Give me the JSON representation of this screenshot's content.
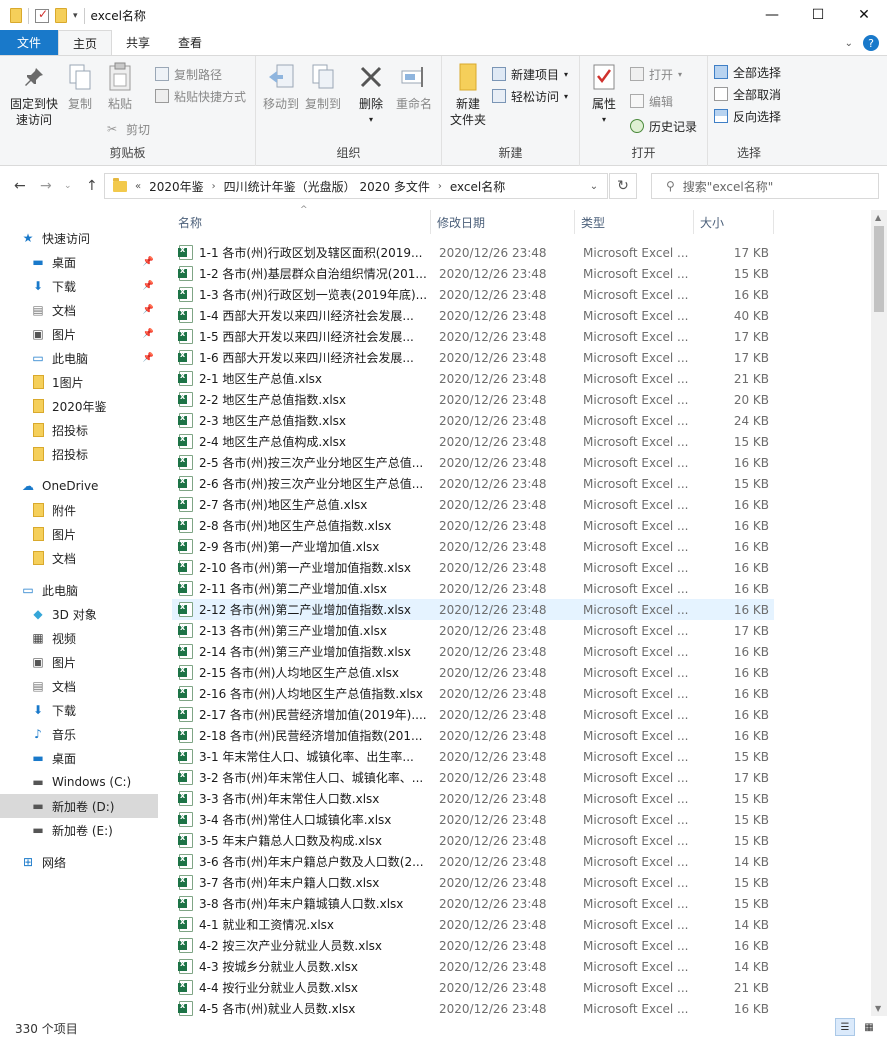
{
  "window": {
    "title": "excel名称",
    "controls": {
      "minimize": "—",
      "maximize": "☐",
      "close": "✕"
    }
  },
  "ribbon_tabs": [
    {
      "label": "文件"
    },
    {
      "label": "主页"
    },
    {
      "label": "共享"
    },
    {
      "label": "查看"
    }
  ],
  "ribbon": {
    "clipboard": {
      "label": "剪贴板",
      "pin_quick": "固定到快\n速访问",
      "copy": "复制",
      "paste": "粘贴",
      "copy_path": "复制路径",
      "paste_shortcut": "粘贴快捷方式",
      "cut": "剪切"
    },
    "organize": {
      "label": "组织",
      "move_to": "移动到",
      "copy_to": "复制到",
      "delete": "删除",
      "rename": "重命名"
    },
    "new": {
      "label": "新建",
      "new_folder": "新建\n文件夹",
      "new_item": "新建项目",
      "easy_access": "轻松访问"
    },
    "open": {
      "label": "打开",
      "properties": "属性",
      "open": "打开",
      "edit": "编辑",
      "history": "历史记录"
    },
    "select": {
      "label": "选择",
      "select_all": "全部选择",
      "select_none": "全部取消",
      "invert": "反向选择"
    }
  },
  "address": {
    "crumbs": [
      "2020年鉴",
      "四川统计年鉴（光盘版） 2020 多文件",
      "excel名称"
    ],
    "overflow": "«",
    "search_placeholder": "搜索\"excel名称\""
  },
  "sidebar": {
    "items": [
      {
        "label": "快速访问",
        "icon": "star-icon",
        "pinned": false,
        "selected": false
      },
      {
        "label": "桌面",
        "icon": "desktop-icon",
        "pinned": true,
        "selected": false
      },
      {
        "label": "下载",
        "icon": "download-icon",
        "pinned": true,
        "selected": false
      },
      {
        "label": "文档",
        "icon": "document-icon",
        "pinned": true,
        "selected": false
      },
      {
        "label": "图片",
        "icon": "pictures-icon",
        "pinned": true,
        "selected": false
      },
      {
        "label": "此电脑",
        "icon": "computer-icon",
        "pinned": true,
        "selected": false
      },
      {
        "label": "1图片",
        "icon": "folder-icon",
        "pinned": false,
        "selected": false
      },
      {
        "label": "2020年鉴",
        "icon": "folder-icon",
        "pinned": false,
        "selected": false
      },
      {
        "label": "招投标",
        "icon": "folder-icon",
        "pinned": false,
        "selected": false
      },
      {
        "label": "招投标",
        "icon": "folder-icon",
        "pinned": false,
        "selected": false
      },
      {
        "label": "OneDrive",
        "icon": "cloud-icon",
        "pinned": false,
        "selected": false
      },
      {
        "label": "附件",
        "icon": "folder-icon",
        "pinned": false,
        "selected": false
      },
      {
        "label": "图片",
        "icon": "folder-icon",
        "pinned": false,
        "selected": false
      },
      {
        "label": "文档",
        "icon": "folder-icon",
        "pinned": false,
        "selected": false
      },
      {
        "label": "此电脑",
        "icon": "computer-icon",
        "pinned": false,
        "selected": false
      },
      {
        "label": "3D 对象",
        "icon": "cube-icon",
        "pinned": false,
        "selected": false
      },
      {
        "label": "视频",
        "icon": "video-icon",
        "pinned": false,
        "selected": false
      },
      {
        "label": "图片",
        "icon": "pictures-icon",
        "pinned": false,
        "selected": false
      },
      {
        "label": "文档",
        "icon": "document-icon",
        "pinned": false,
        "selected": false
      },
      {
        "label": "下载",
        "icon": "download-icon",
        "pinned": false,
        "selected": false
      },
      {
        "label": "音乐",
        "icon": "music-icon",
        "pinned": false,
        "selected": false
      },
      {
        "label": "桌面",
        "icon": "desktop-icon",
        "pinned": false,
        "selected": false
      },
      {
        "label": "Windows (C:)",
        "icon": "drive-icon",
        "pinned": false,
        "selected": false
      },
      {
        "label": "新加卷 (D:)",
        "icon": "drive-icon",
        "pinned": false,
        "selected": true
      },
      {
        "label": "新加卷 (E:)",
        "icon": "drive-icon",
        "pinned": false,
        "selected": false
      },
      {
        "label": "网络",
        "icon": "network-icon",
        "pinned": false,
        "selected": false
      }
    ]
  },
  "columns": {
    "name": "名称",
    "date": "修改日期",
    "type": "类型",
    "size": "大小"
  },
  "files": [
    {
      "name": "1-1  各市(州)行政区划及辖区面积(2019...",
      "date": "2020/12/26 23:48",
      "type": "Microsoft Excel ...",
      "size": "17 KB"
    },
    {
      "name": "1-2  各市(州)基层群众自治组织情况(201...",
      "date": "2020/12/26 23:48",
      "type": "Microsoft Excel ...",
      "size": "15 KB"
    },
    {
      "name": "1-3  各市(州)行政区划一览表(2019年底)...",
      "date": "2020/12/26 23:48",
      "type": "Microsoft Excel ...",
      "size": "16 KB"
    },
    {
      "name": "1-4  西部大开发以来四川经济社会发展...",
      "date": "2020/12/26 23:48",
      "type": "Microsoft Excel ...",
      "size": "40 KB"
    },
    {
      "name": "1-5  西部大开发以来四川经济社会发展...",
      "date": "2020/12/26 23:48",
      "type": "Microsoft Excel ...",
      "size": "17 KB"
    },
    {
      "name": "1-6  西部大开发以来四川经济社会发展...",
      "date": "2020/12/26 23:48",
      "type": "Microsoft Excel ...",
      "size": "17 KB"
    },
    {
      "name": "2-1  地区生产总值.xlsx",
      "date": "2020/12/26 23:48",
      "type": "Microsoft Excel ...",
      "size": "21 KB"
    },
    {
      "name": "2-2  地区生产总值指数.xlsx",
      "date": "2020/12/26 23:48",
      "type": "Microsoft Excel ...",
      "size": "20 KB"
    },
    {
      "name": "2-3  地区生产总值指数.xlsx",
      "date": "2020/12/26 23:48",
      "type": "Microsoft Excel ...",
      "size": "24 KB"
    },
    {
      "name": "2-4  地区生产总值构成.xlsx",
      "date": "2020/12/26 23:48",
      "type": "Microsoft Excel ...",
      "size": "15 KB"
    },
    {
      "name": "2-5  各市(州)按三次产业分地区生产总值...",
      "date": "2020/12/26 23:48",
      "type": "Microsoft Excel ...",
      "size": "16 KB"
    },
    {
      "name": "2-6  各市(州)按三次产业分地区生产总值...",
      "date": "2020/12/26 23:48",
      "type": "Microsoft Excel ...",
      "size": "15 KB"
    },
    {
      "name": "2-7  各市(州)地区生产总值.xlsx",
      "date": "2020/12/26 23:48",
      "type": "Microsoft Excel ...",
      "size": "16 KB"
    },
    {
      "name": "2-8  各市(州)地区生产总值指数.xlsx",
      "date": "2020/12/26 23:48",
      "type": "Microsoft Excel ...",
      "size": "16 KB"
    },
    {
      "name": "2-9  各市(州)第一产业增加值.xlsx",
      "date": "2020/12/26 23:48",
      "type": "Microsoft Excel ...",
      "size": "16 KB"
    },
    {
      "name": "2-10  各市(州)第一产业增加值指数.xlsx",
      "date": "2020/12/26 23:48",
      "type": "Microsoft Excel ...",
      "size": "16 KB"
    },
    {
      "name": "2-11  各市(州)第二产业增加值.xlsx",
      "date": "2020/12/26 23:48",
      "type": "Microsoft Excel ...",
      "size": "16 KB"
    },
    {
      "name": "2-12  各市(州)第二产业增加值指数.xlsx",
      "date": "2020/12/26 23:48",
      "type": "Microsoft Excel ...",
      "size": "16 KB"
    },
    {
      "name": "2-13  各市(州)第三产业增加值.xlsx",
      "date": "2020/12/26 23:48",
      "type": "Microsoft Excel ...",
      "size": "17 KB"
    },
    {
      "name": "2-14  各市(州)第三产业增加值指数.xlsx",
      "date": "2020/12/26 23:48",
      "type": "Microsoft Excel ...",
      "size": "16 KB"
    },
    {
      "name": "2-15  各市(州)人均地区生产总值.xlsx",
      "date": "2020/12/26 23:48",
      "type": "Microsoft Excel ...",
      "size": "16 KB"
    },
    {
      "name": "2-16  各市(州)人均地区生产总值指数.xlsx",
      "date": "2020/12/26 23:48",
      "type": "Microsoft Excel ...",
      "size": "16 KB"
    },
    {
      "name": "2-17  各市(州)民营经济增加值(2019年)....",
      "date": "2020/12/26 23:48",
      "type": "Microsoft Excel ...",
      "size": "16 KB"
    },
    {
      "name": "2-18  各市(州)民营经济增加值指数(201...",
      "date": "2020/12/26 23:48",
      "type": "Microsoft Excel ...",
      "size": "16 KB"
    },
    {
      "name": "3-1  年末常住人口、城镇化率、出生率...",
      "date": "2020/12/26 23:48",
      "type": "Microsoft Excel ...",
      "size": "15 KB"
    },
    {
      "name": "3-2  各市(州)年末常住人口、城镇化率、...",
      "date": "2020/12/26 23:48",
      "type": "Microsoft Excel ...",
      "size": "17 KB"
    },
    {
      "name": "3-3  各市(州)年末常住人口数.xlsx",
      "date": "2020/12/26 23:48",
      "type": "Microsoft Excel ...",
      "size": "15 KB"
    },
    {
      "name": "3-4  各市(州)常住人口城镇化率.xlsx",
      "date": "2020/12/26 23:48",
      "type": "Microsoft Excel ...",
      "size": "15 KB"
    },
    {
      "name": "3-5  年末户籍总人口数及构成.xlsx",
      "date": "2020/12/26 23:48",
      "type": "Microsoft Excel ...",
      "size": "15 KB"
    },
    {
      "name": "3-6  各市(州)年末户籍总户数及人口数(2...",
      "date": "2020/12/26 23:48",
      "type": "Microsoft Excel ...",
      "size": "14 KB"
    },
    {
      "name": "3-7  各市(州)年末户籍人口数.xlsx",
      "date": "2020/12/26 23:48",
      "type": "Microsoft Excel ...",
      "size": "15 KB"
    },
    {
      "name": "3-8  各市(州)年末户籍城镇人口数.xlsx",
      "date": "2020/12/26 23:48",
      "type": "Microsoft Excel ...",
      "size": "15 KB"
    },
    {
      "name": "4-1  就业和工资情况.xlsx",
      "date": "2020/12/26 23:48",
      "type": "Microsoft Excel ...",
      "size": "14 KB"
    },
    {
      "name": "4-2  按三次产业分就业人员数.xlsx",
      "date": "2020/12/26 23:48",
      "type": "Microsoft Excel ...",
      "size": "16 KB"
    },
    {
      "name": "4-3  按城乡分就业人员数.xlsx",
      "date": "2020/12/26 23:48",
      "type": "Microsoft Excel ...",
      "size": "14 KB"
    },
    {
      "name": "4-4  按行业分就业人员数.xlsx",
      "date": "2020/12/26 23:48",
      "type": "Microsoft Excel ...",
      "size": "21 KB"
    },
    {
      "name": "4-5  各市(州)就业人员数.xlsx",
      "date": "2020/12/26 23:48",
      "type": "Microsoft Excel ...",
      "size": "16 KB"
    }
  ],
  "hovered_row": 17,
  "status": {
    "count": "330 个项目"
  }
}
